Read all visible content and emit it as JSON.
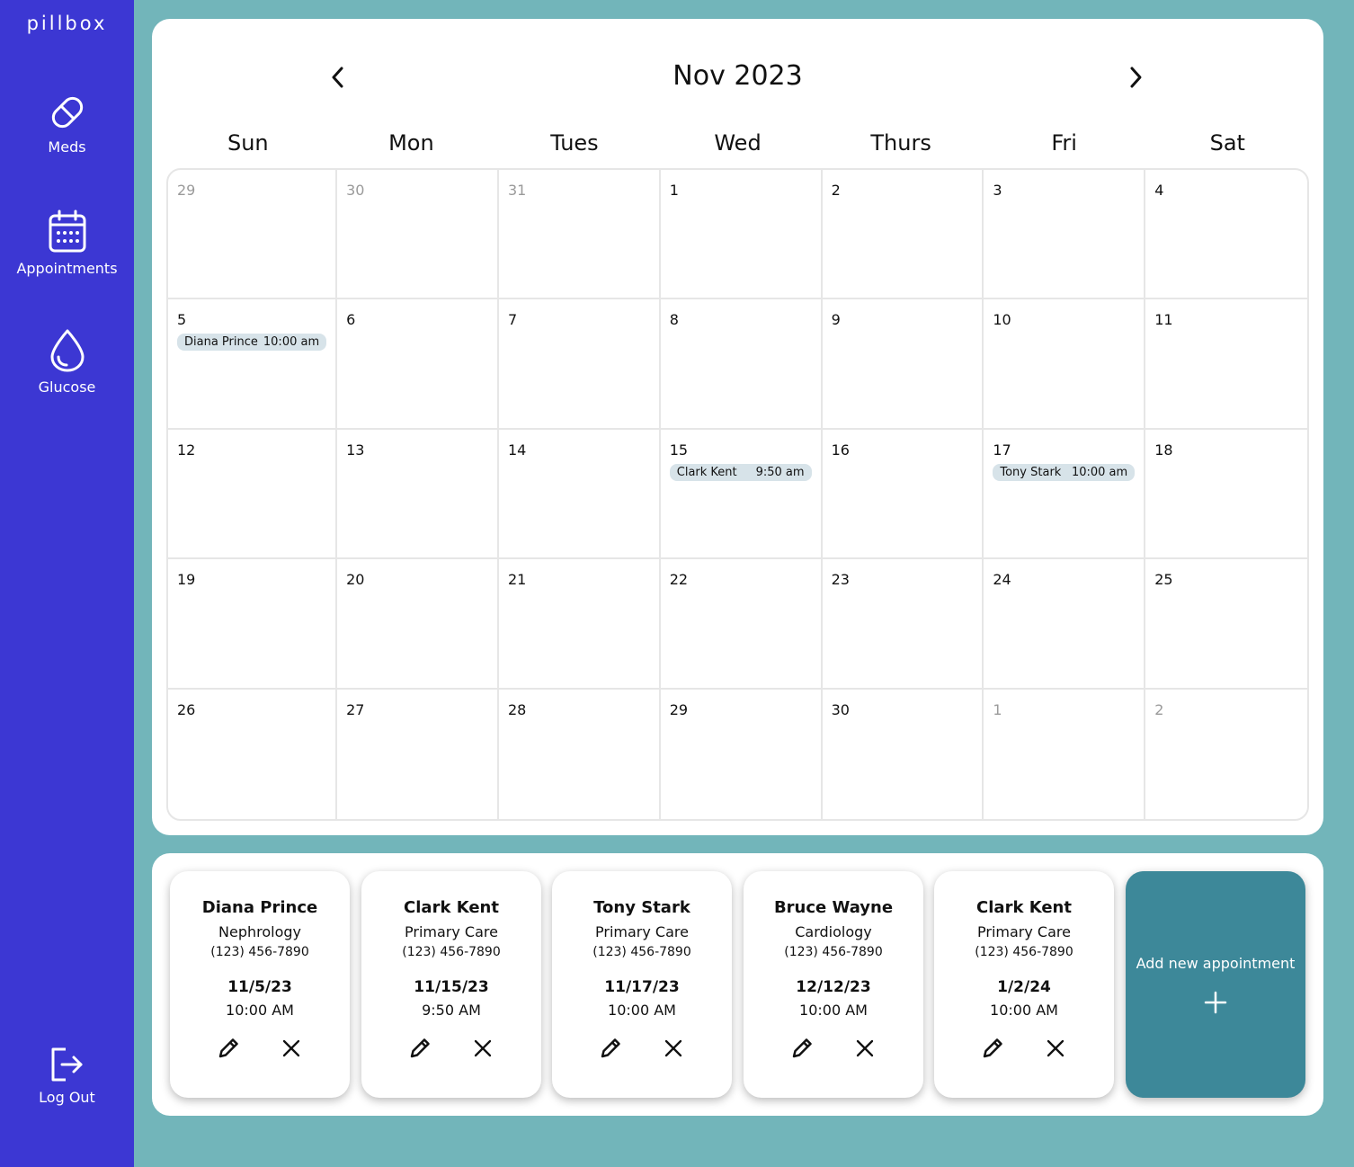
{
  "sidebar": {
    "brand": "pillbox",
    "items": [
      {
        "label": "Meds",
        "icon": "pill-icon"
      },
      {
        "label": "Appointments",
        "icon": "calendar-icon"
      },
      {
        "label": "Glucose",
        "icon": "droplet-icon"
      }
    ],
    "logout": {
      "label": "Log Out",
      "icon": "logout-icon"
    }
  },
  "calendar": {
    "title": "Nov 2023",
    "weekdays": [
      "Sun",
      "Mon",
      "Tues",
      "Wed",
      "Thurs",
      "Fri",
      "Sat"
    ],
    "days": [
      {
        "n": "29",
        "muted": true
      },
      {
        "n": "30",
        "muted": true
      },
      {
        "n": "31",
        "muted": true
      },
      {
        "n": "1"
      },
      {
        "n": "2"
      },
      {
        "n": "3"
      },
      {
        "n": "4"
      },
      {
        "n": "5",
        "event": {
          "name": "Diana Prince",
          "time": "10:00 am"
        }
      },
      {
        "n": "6"
      },
      {
        "n": "7"
      },
      {
        "n": "8"
      },
      {
        "n": "9"
      },
      {
        "n": "10"
      },
      {
        "n": "11"
      },
      {
        "n": "12"
      },
      {
        "n": "13"
      },
      {
        "n": "14"
      },
      {
        "n": "15",
        "event": {
          "name": "Clark Kent",
          "time": "9:50 am"
        }
      },
      {
        "n": "16"
      },
      {
        "n": "17",
        "event": {
          "name": "Tony Stark",
          "time": "10:00 am"
        }
      },
      {
        "n": "18"
      },
      {
        "n": "19"
      },
      {
        "n": "20"
      },
      {
        "n": "21"
      },
      {
        "n": "22"
      },
      {
        "n": "23"
      },
      {
        "n": "24"
      },
      {
        "n": "25"
      },
      {
        "n": "26"
      },
      {
        "n": "27"
      },
      {
        "n": "28"
      },
      {
        "n": "29"
      },
      {
        "n": "30"
      },
      {
        "n": "1",
        "muted": true
      },
      {
        "n": "2",
        "muted": true
      }
    ]
  },
  "appointments": [
    {
      "name": "Diana Prince",
      "specialty": "Nephrology",
      "phone": "(123) 456-7890",
      "date": "11/5/23",
      "time": "10:00 AM"
    },
    {
      "name": "Clark Kent",
      "specialty": "Primary Care",
      "phone": "(123) 456-7890",
      "date": "11/15/23",
      "time": "9:50 AM"
    },
    {
      "name": "Tony Stark",
      "specialty": "Primary Care",
      "phone": "(123) 456-7890",
      "date": "11/17/23",
      "time": "10:00 AM"
    },
    {
      "name": "Bruce Wayne",
      "specialty": "Cardiology",
      "phone": "(123) 456-7890",
      "date": "12/12/23",
      "time": "10:00 AM"
    },
    {
      "name": "Clark Kent",
      "specialty": "Primary Care",
      "phone": "(123) 456-7890",
      "date": "1/2/24",
      "time": "10:00 AM"
    }
  ],
  "add_appointment_label": "Add new appointment",
  "colors": {
    "sidebar": "#3c37d3",
    "background": "#72b5ba",
    "add_card": "#3d8899",
    "event_pill": "#d7e3e9"
  }
}
